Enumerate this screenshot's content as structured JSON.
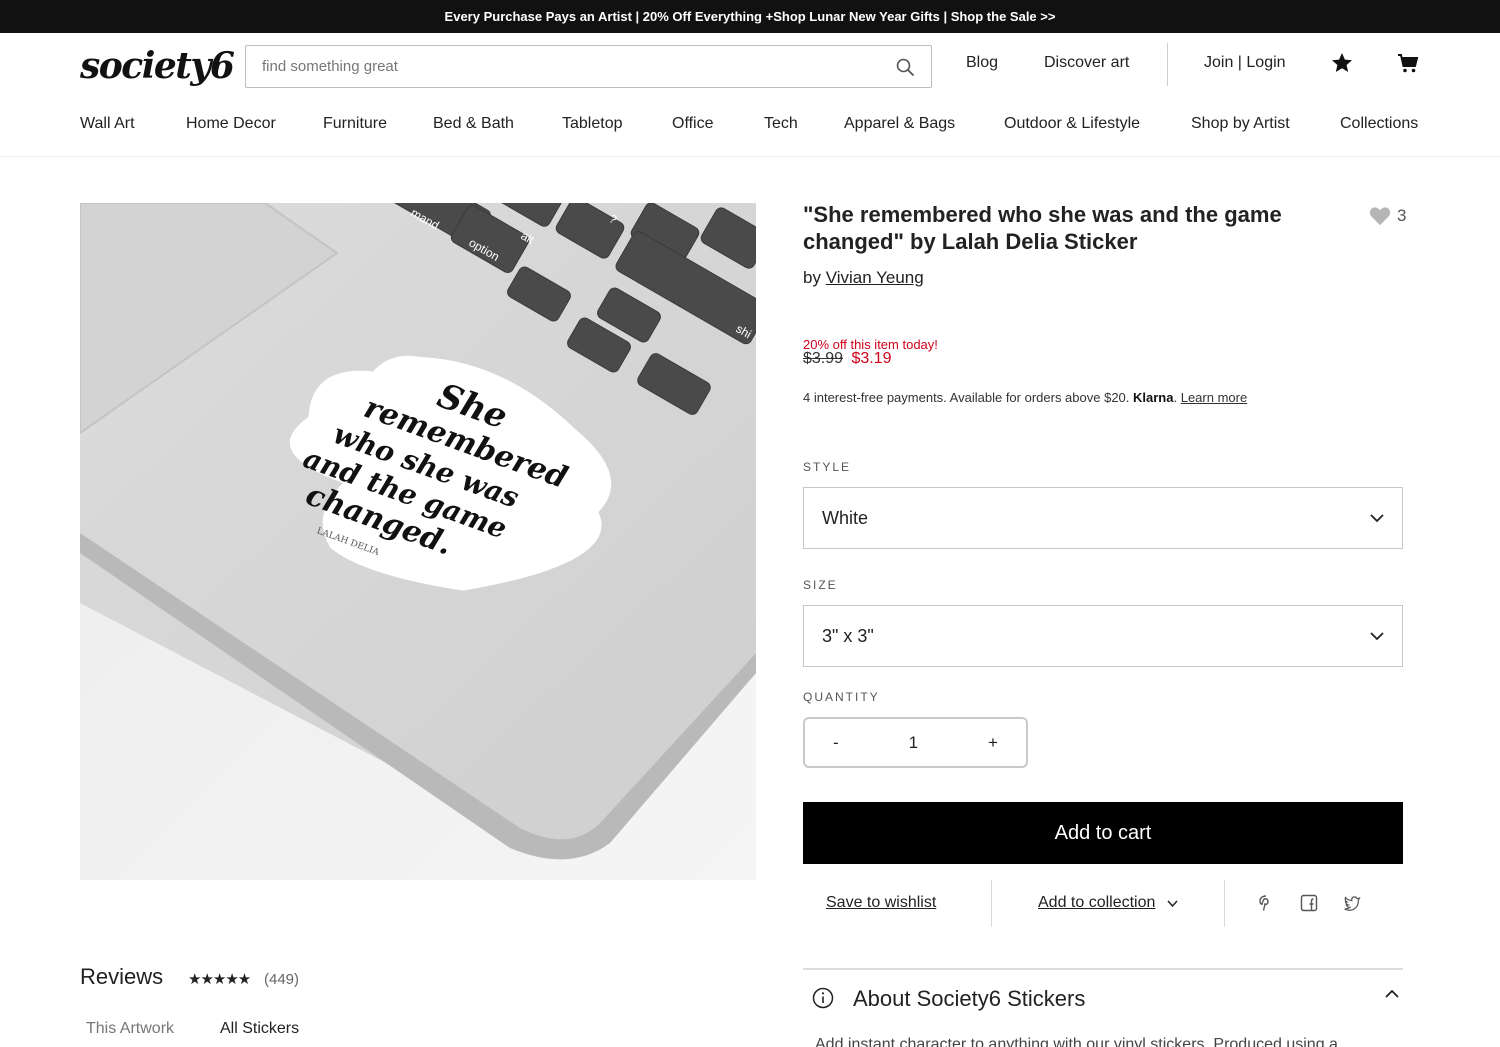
{
  "promo_bar": "Every Purchase Pays an Artist | 20% Off Everything +Shop Lunar New Year Gifts | Shop the Sale >>",
  "logo": "society6",
  "search": {
    "placeholder": "find something great"
  },
  "header_links": {
    "blog": "Blog",
    "discover": "Discover art",
    "account": "Join | Login"
  },
  "nav": [
    "Wall Art",
    "Home Decor",
    "Furniture",
    "Bed & Bath",
    "Tabletop",
    "Office",
    "Tech",
    "Apparel & Bags",
    "Outdoor & Lifestyle",
    "Shop by Artist",
    "Collections"
  ],
  "product": {
    "title": "\"She remembered who she was and the game changed\" by Lalah Delia Sticker",
    "favorites": "3",
    "by_label": "by",
    "artist": "Vivian Yeung",
    "promo_note": "20% off this item today!",
    "price_old": "$3.99",
    "price_new": "$3.19",
    "klarna_text": "4 interest-free payments. Available for orders above $20.",
    "klarna_brand": "Klarna",
    "klarna_link": "Learn more",
    "image_lines": [
      "She",
      "remembered",
      "who she was",
      "and the game",
      "changed."
    ],
    "image_credit": "LALAH DELIA",
    "image_keys": [
      "mand",
      "alt",
      "option",
      "?",
      "shi"
    ]
  },
  "style": {
    "label": "STYLE",
    "value": "White"
  },
  "size": {
    "label": "SIZE",
    "value": "3\" x 3\""
  },
  "quantity": {
    "label": "QUANTITY",
    "minus": "-",
    "value": "1",
    "plus": "+"
  },
  "add_to_cart": "Add to cart",
  "actions": {
    "wishlist": "Save to wishlist",
    "collection": "Add to collection"
  },
  "reviews": {
    "title": "Reviews",
    "stars": "★★★★★",
    "count": "(449)",
    "tab_artwork": "This Artwork",
    "tab_all": "All Stickers"
  },
  "about": {
    "title": "About Society6 Stickers",
    "text": "Add instant character to anything with our vinyl stickers. Produced using a"
  },
  "colors": {
    "sale_red": "#d0021b",
    "button_black": "#000000",
    "promo_bg": "#111111"
  }
}
